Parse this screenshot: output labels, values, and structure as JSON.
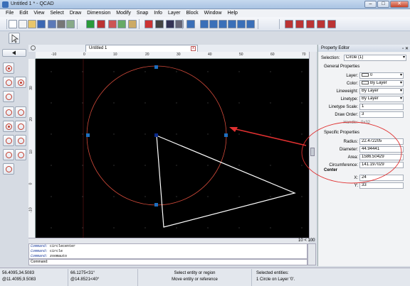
{
  "window": {
    "title": "Untitled 1 * - QCAD",
    "minimize": "–",
    "maximize": "□",
    "close": "✕"
  },
  "menu": [
    "File",
    "Edit",
    "View",
    "Select",
    "Draw",
    "Dimension",
    "Modify",
    "Snap",
    "Info",
    "Layer",
    "Block",
    "Window",
    "Help"
  ],
  "toolbar_icons": [
    "new-document-icon",
    "open-icon",
    "save-icon",
    "save-as-icon",
    "print-icon",
    "print-preview-icon",
    "undo-icon",
    "redo-icon",
    "cut-icon",
    "copy-icon",
    "paste-icon",
    "pen-icon",
    "color-icon",
    "circle-icon",
    "grid-icon",
    "zoom-in-icon",
    "zoom-out-icon",
    "zoom-auto-icon",
    "zoom-window-icon",
    "zoom-pan-icon",
    "zoom-previous-icon",
    "zoom-selection-icon",
    "snap-grid-icon",
    "snap-endpoint-icon",
    "snap-intersection-icon",
    "snap-center-icon",
    "snap-reference-icon"
  ],
  "document_tab": {
    "title": "Untitled 1",
    "close": "x"
  },
  "ruler": {
    "top": [
      "-10",
      "0",
      "10",
      "20",
      "30",
      "40",
      "50",
      "60",
      "70"
    ],
    "left": [
      "30",
      "20",
      "10",
      "0",
      "-10"
    ]
  },
  "scale_label": "10 < 100",
  "command_history": [
    {
      "prefix": "Command:",
      "text": "circlecenter"
    },
    {
      "prefix": "Command:",
      "text": "circle"
    },
    {
      "prefix": "Command:",
      "text": "zoomauto"
    }
  ],
  "command_prompt": "Command:",
  "status": {
    "coords_abs": "56.4095,34.5083",
    "coords_rel": "@11.4095,9.5083",
    "polar_abs": "66.1275<31°",
    "polar_rel": "@14.8521<40°",
    "hint_1": "Select entity or region",
    "hint_2": "Move entity or reference",
    "selected_title": "Selected entities:",
    "selected_detail": "1 Circle on Layer '0'."
  },
  "property_editor": {
    "title": "Property Editor",
    "selection_label": "Selection:",
    "selection_value": "Circle (1)",
    "general_title": "General Properties",
    "general": [
      {
        "label": "Layer:",
        "value": "0",
        "swatch": true
      },
      {
        "label": "Color:",
        "value": "By Layer",
        "swatch": true
      },
      {
        "label": "Lineweight:",
        "value": "By Layer",
        "swatch": false
      },
      {
        "label": "Linetype:",
        "value": "By Layer",
        "swatch": false
      },
      {
        "label": "Linetype Scale:",
        "value": "1",
        "swatch": false
      },
      {
        "label": "Draw Order:",
        "value": "3",
        "swatch": false
      }
    ],
    "handle_label": "Handle:",
    "handle_value": "0x32",
    "specific_title": "Specific Properties",
    "specific": [
      {
        "label": "Radius:",
        "value": "22.472205"
      },
      {
        "label": "Diameter:",
        "value": "44.94441"
      },
      {
        "label": "Area:",
        "value": "1586.50429"
      },
      {
        "label": "Circumference:",
        "value": "141.197029"
      }
    ],
    "center_title": "Center",
    "center": [
      {
        "label": "X:",
        "value": "24"
      },
      {
        "label": "Y:",
        "value": "33"
      }
    ]
  },
  "colors": {
    "circle": "#d24a3a",
    "grip": "#1e6fbf",
    "triangle": "#ffffff",
    "annotation": "#e03030",
    "canvas": "#000000"
  }
}
